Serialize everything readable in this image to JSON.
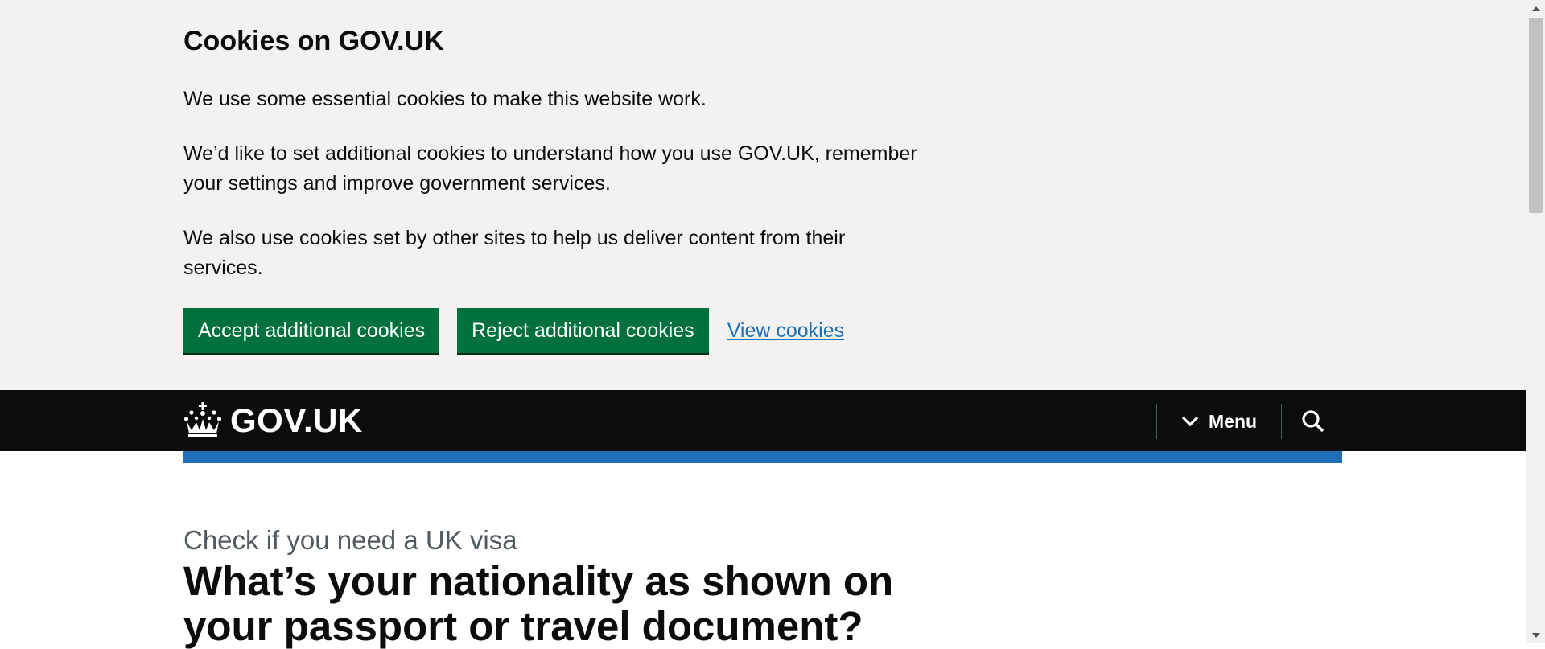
{
  "cookie_banner": {
    "title": "Cookies on GOV.UK",
    "paragraphs": [
      "We use some essential cookies to make this website work.",
      "We’d like to set additional cookies to understand how you use GOV.UK, remember your settings and improve government services.",
      "We also use cookies set by other sites to help us deliver content from their services."
    ],
    "accept_label": "Accept additional cookies",
    "reject_label": "Reject additional cookies",
    "view_label": "View cookies"
  },
  "header": {
    "logo_text": "GOV.UK",
    "menu_label": "Menu"
  },
  "main": {
    "caption": "Check if you need a UK visa",
    "heading": "What’s your nationality as shown on your passport or travel document?"
  },
  "colors": {
    "banner_bg": "#f3f2f1",
    "button_green": "#00703c",
    "link_blue": "#1d70b8",
    "header_black": "#0b0c0c",
    "accent_blue": "#1d70b8"
  },
  "icons": [
    "crown-icon",
    "chevron-down-icon",
    "search-icon",
    "scroll-up-arrow",
    "scroll-down-arrow"
  ]
}
